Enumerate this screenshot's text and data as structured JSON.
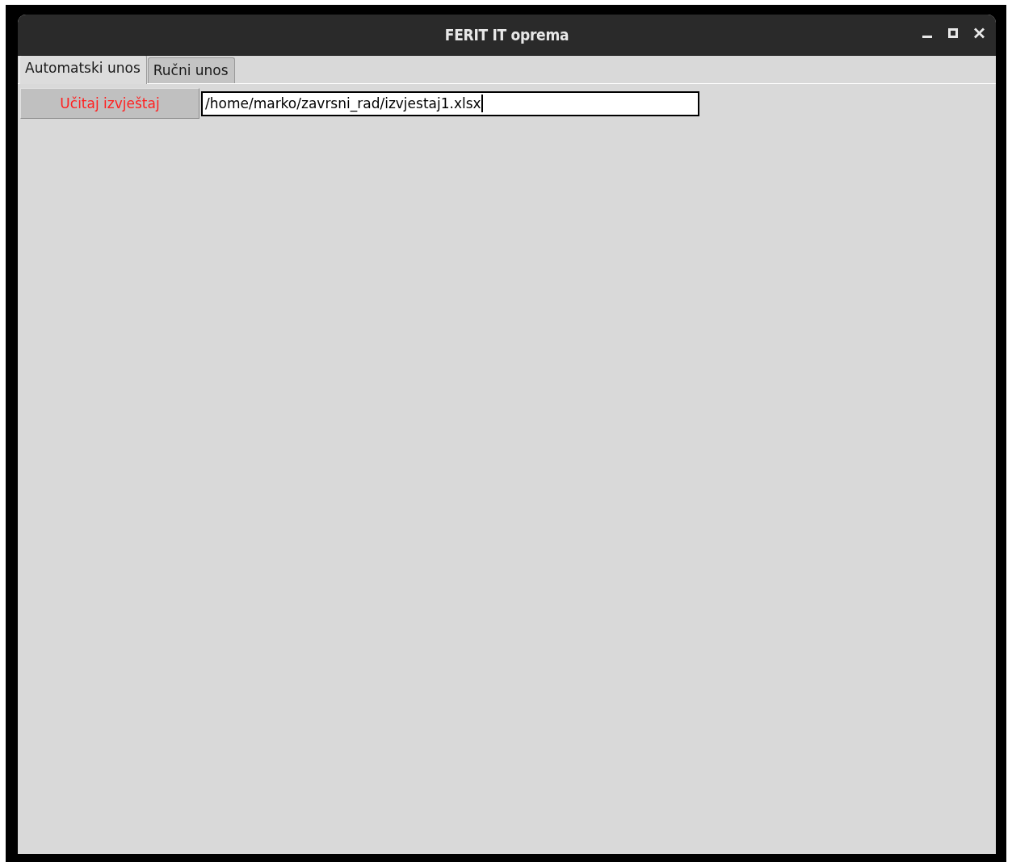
{
  "window": {
    "title": "FERIT IT oprema"
  },
  "tabs": [
    {
      "label": "Automatski unos",
      "selected": true
    },
    {
      "label": "Ručni unos",
      "selected": false
    }
  ],
  "load_button": {
    "label": "Učitaj izvještaj"
  },
  "path_field": {
    "value": "/home/marko/zavrsni_rad/izvjestaj1.xlsx"
  }
}
